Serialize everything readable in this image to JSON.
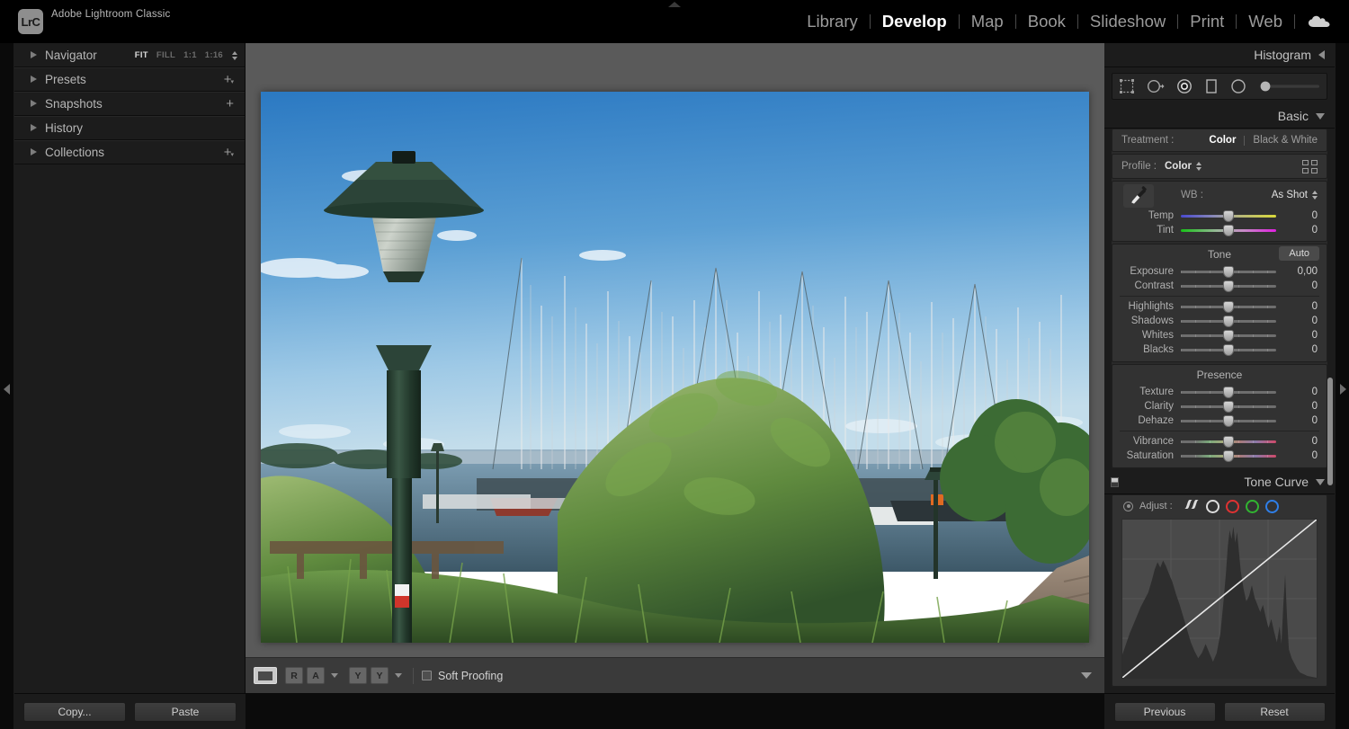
{
  "app": {
    "logo_text": "LrC",
    "title": "Adobe Lightroom Classic"
  },
  "modules": [
    {
      "label": "Library",
      "active": false
    },
    {
      "label": "Develop",
      "active": true
    },
    {
      "label": "Map",
      "active": false
    },
    {
      "label": "Book",
      "active": false
    },
    {
      "label": "Slideshow",
      "active": false
    },
    {
      "label": "Print",
      "active": false
    },
    {
      "label": "Web",
      "active": false
    }
  ],
  "left_panel": {
    "panels": [
      {
        "label": "Navigator",
        "adder": "none"
      },
      {
        "label": "Presets",
        "adder": "plus-caret"
      },
      {
        "label": "Snapshots",
        "adder": "plus"
      },
      {
        "label": "History",
        "adder": "none"
      },
      {
        "label": "Collections",
        "adder": "plus-caret"
      }
    ],
    "zoom_levels": [
      {
        "label": "FIT",
        "selected": true
      },
      {
        "label": "FILL",
        "selected": false
      },
      {
        "label": "1:1",
        "selected": false
      },
      {
        "label": "1:16",
        "selected": false
      }
    ],
    "buttons": {
      "copy": "Copy...",
      "paste": "Paste"
    }
  },
  "center_toolbar": {
    "view_single": "single-view",
    "before_after_left": "R",
    "before_after_right": "A",
    "ya": "Y",
    "yb": "Y",
    "soft_proofing_label": "Soft Proofing",
    "soft_proofing_checked": false
  },
  "right_panel": {
    "histogram": {
      "title": "Histogram"
    },
    "toolstrip": [
      {
        "name": "crop-overlay-icon"
      },
      {
        "name": "spot-removal-icon"
      },
      {
        "name": "red-eye-icon"
      },
      {
        "name": "masking-rect-icon"
      },
      {
        "name": "radial-gradient-icon"
      },
      {
        "name": "amount-slider-icon"
      }
    ],
    "basic": {
      "title": "Basic",
      "treatment_label": "Treatment :",
      "treatment_options": [
        {
          "label": "Color",
          "selected": true
        },
        {
          "label": "Black & White",
          "selected": false
        }
      ],
      "profile_label": "Profile :",
      "profile_value": "Color",
      "wb_label": "WB :",
      "wb_value": "As Shot",
      "wb_sliders": [
        {
          "name": "Temp",
          "value": "0",
          "knob_pct": 50,
          "track": "temp"
        },
        {
          "name": "Tint",
          "value": "0",
          "knob_pct": 50,
          "track": "tint"
        }
      ],
      "tone_title": "Tone",
      "auto_label": "Auto",
      "tone_sliders": [
        {
          "name": "Exposure",
          "value": "0,00",
          "knob_pct": 50,
          "track": "plain"
        },
        {
          "name": "Contrast",
          "value": "0",
          "knob_pct": 50,
          "track": "plain"
        },
        {
          "name": "Highlights",
          "value": "0",
          "knob_pct": 50,
          "track": "plain"
        },
        {
          "name": "Shadows",
          "value": "0",
          "knob_pct": 50,
          "track": "plain"
        },
        {
          "name": "Whites",
          "value": "0",
          "knob_pct": 50,
          "track": "plain"
        },
        {
          "name": "Blacks",
          "value": "0",
          "knob_pct": 50,
          "track": "plain"
        }
      ],
      "presence_title": "Presence",
      "presence_sliders": [
        {
          "name": "Texture",
          "value": "0",
          "knob_pct": 50,
          "track": "plain"
        },
        {
          "name": "Clarity",
          "value": "0",
          "knob_pct": 50,
          "track": "plain"
        },
        {
          "name": "Dehaze",
          "value": "0",
          "knob_pct": 50,
          "track": "plain"
        }
      ],
      "color_sliders": [
        {
          "name": "Vibrance",
          "value": "0",
          "knob_pct": 50,
          "track": "vib"
        },
        {
          "name": "Saturation",
          "value": "0",
          "knob_pct": 50,
          "track": "vib"
        }
      ]
    },
    "tone_curve": {
      "title": "Tone Curve",
      "adjust_label": "Adjust :",
      "channels": [
        {
          "name": "parametric",
          "color": "#dddddd"
        },
        {
          "name": "point-white",
          "color": "#dddddd"
        },
        {
          "name": "point-red",
          "color": "#e03232"
        },
        {
          "name": "point-green",
          "color": "#31b531"
        },
        {
          "name": "point-blue",
          "color": "#2f7fe8"
        }
      ]
    },
    "buttons": {
      "previous": "Previous",
      "reset": "Reset"
    }
  },
  "photo": {
    "description": "Harbor scene with green lamp post in foreground, sailboat marina with many masts, trees and reeds, blue sky",
    "sky_top": "#2f7fc4",
    "sky_bottom": "#9cc8e4",
    "lamp_color": "#2c4438",
    "water_color": "#5d7f93",
    "foliage_color": "#4e7d3a",
    "path_color": "#8a7a6e"
  }
}
